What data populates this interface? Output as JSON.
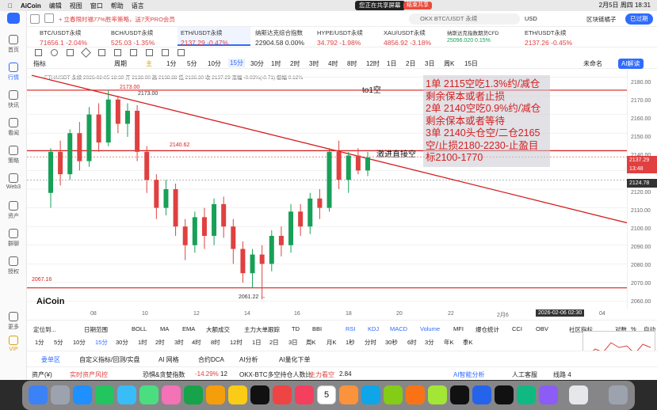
{
  "menubar": {
    "app": "AiCoin",
    "menus": [
      "编辑",
      "视图",
      "窗口",
      "帮助",
      "语言"
    ],
    "sharing": "您正在共享屏幕",
    "end_share": "结束共享",
    "clock": "2月5日 周四 18:31"
  },
  "sidebar": {
    "items": [
      "首页",
      "行情",
      "快讯",
      "看闻",
      "策略",
      "Web3",
      "资产",
      "群聊",
      "授权",
      "更多",
      "VIP"
    ]
  },
  "topbar": {
    "promo": "+ 立春限时福77%胜率策略，送7天PRO会员",
    "search_placeholder": "OKX BTC/USDT 永续",
    "currency": "USD",
    "user": "区块链橘子",
    "status": "已过期"
  },
  "tickers": [
    {
      "name": "BTC/USDT永续",
      "price": "71656.1",
      "change": "-2.04%"
    },
    {
      "name": "BCH/USDT永续",
      "price": "525.03",
      "change": "-1.35%"
    },
    {
      "name": "ETH/USDT永续",
      "price": "2137.29",
      "change": "-0.47%"
    },
    {
      "name": "纳斯达克综合指数",
      "price": "22904.58",
      "change": "0.00%"
    },
    {
      "name": "HYPE/USDT永续",
      "price": "34.792",
      "change": "-1.98%"
    },
    {
      "name": "XAU/USDT永续",
      "price": "4856.92",
      "change": "-3.18%"
    },
    {
      "name": "纳斯达克指数期货CFD",
      "price": "25096.020",
      "change": "0.15%"
    },
    {
      "name": "ETH/USDT永续",
      "price": "2137.26",
      "change": "-0.45%"
    }
  ],
  "toolbar": {
    "indicator": "指标",
    "period": "周期",
    "timeframes": [
      "主",
      "1分",
      "5分",
      "10分",
      "15分",
      "30分",
      "1时",
      "2时",
      "3时",
      "4时",
      "8时",
      "12时",
      "1日",
      "2日",
      "3日",
      "周K",
      "15日"
    ],
    "active_tf": "15分",
    "pending": "未命名",
    "ai": "AI解读"
  },
  "chart": {
    "legend": "ETH/USDT 永续  2026-02-05 18:30  开 2138.00  高 2138.88  低 2136.30  收 2137.29  涨幅 -0.03%(-0.71)  振幅 0.12%",
    "title_note": "to1空",
    "note_box": [
      "1单 2115空吃1.3%约/减仓",
      "剩余保本或者止损",
      "2单 2140空吃0.9%约/减仓",
      "剩余保本或者等待",
      "3单 2140头仓空/二仓2165",
      "空/止损2180-2230-止盈目",
      "标2100-1770"
    ],
    "jinji": "激进直接空",
    "high_label": "2173.00",
    "level_label": "2140.62",
    "low_label": "2067.16",
    "low_point": "2061.22",
    "logo": "AiCoin",
    "y_ticks": [
      "2180.00",
      "2170.00",
      "2160.00",
      "2150.00",
      "2140.00",
      "2130.00",
      "2120.00",
      "2110.00",
      "2100.00",
      "2090.00",
      "2080.00",
      "2070.00",
      "2060.00"
    ],
    "price_tag": "2137.29",
    "countdown": "13:48",
    "cross_price": "2124.78",
    "x_ticks": [
      "08",
      "10",
      "12",
      "14",
      "16",
      "18",
      "20",
      "22",
      "2月6",
      "04"
    ],
    "x_highlight": "2026-02-06 02:30",
    "y_min": 2056,
    "y_max": 2184
  },
  "chart_data": {
    "type": "candlestick",
    "ylim": [
      2056,
      2184
    ],
    "candles": [
      [
        2118,
        2140,
        2110,
        2142
      ],
      [
        2140,
        2128,
        2122,
        2146
      ],
      [
        2128,
        2150,
        2125,
        2152
      ],
      [
        2150,
        2135,
        2130,
        2156
      ],
      [
        2135,
        2160,
        2132,
        2164
      ],
      [
        2160,
        2145,
        2140,
        2166
      ],
      [
        2145,
        2168,
        2143,
        2173
      ],
      [
        2168,
        2155,
        2150,
        2170
      ],
      [
        2155,
        2162,
        2148,
        2166
      ],
      [
        2162,
        2140,
        2135,
        2165
      ],
      [
        2140,
        2125,
        2118,
        2143
      ],
      [
        2125,
        2110,
        2104,
        2128
      ],
      [
        2110,
        2120,
        2106,
        2125
      ],
      [
        2120,
        2100,
        2095,
        2123
      ],
      [
        2100,
        2090,
        2082,
        2104
      ],
      [
        2090,
        2105,
        2086,
        2108
      ],
      [
        2105,
        2095,
        2088,
        2110
      ],
      [
        2095,
        2112,
        2090,
        2115
      ],
      [
        2112,
        2100,
        2094,
        2116
      ],
      [
        2100,
        2088,
        2080,
        2104
      ],
      [
        2088,
        2075,
        2070,
        2092
      ],
      [
        2075,
        2085,
        2067,
        2088
      ],
      [
        2085,
        2080,
        2061,
        2090
      ],
      [
        2080,
        2095,
        2076,
        2098
      ],
      [
        2095,
        2090,
        2084,
        2100
      ],
      [
        2090,
        2108,
        2086,
        2112
      ],
      [
        2108,
        2100,
        2095,
        2112
      ],
      [
        2100,
        2115,
        2096,
        2118
      ],
      [
        2115,
        2110,
        2104,
        2120
      ],
      [
        2110,
        2140,
        2108,
        2142
      ],
      [
        2140,
        2125,
        2120,
        2146
      ],
      [
        2125,
        2138,
        2118,
        2140
      ],
      [
        2138,
        2130,
        2128,
        2142
      ],
      [
        2130,
        2137,
        2127,
        2140
      ]
    ]
  },
  "indicators": [
    "定位到...",
    "日期范围",
    "BOLL",
    "MA",
    "EMA",
    "大额成交",
    "主力大单跟踪",
    "TD",
    "BBI",
    "RSI",
    "KDJ",
    "MACD",
    "Volume",
    "MFI",
    "爆仓统计",
    "CCI",
    "OBV",
    "社区指标",
    "对数",
    "%",
    "自动"
  ],
  "tf_row": [
    "1分",
    "5分",
    "10分",
    "15分",
    "30分",
    "1时",
    "2时",
    "3时",
    "4时",
    "8时",
    "12时",
    "1日",
    "2日",
    "3日",
    "周K",
    "月K",
    "1秒",
    "分时",
    "30秒",
    "6时",
    "3分",
    "年K",
    "季K"
  ],
  "bottom_tabs": [
    "委单区",
    "自定义指标/回测/实盘",
    "AI 网格",
    "合约DCA",
    "AI分析",
    "AI量化下单"
  ],
  "status": {
    "assets": "资产(¥)",
    "risk": "实时资产风控",
    "fear": "恐惧&贪婪指数",
    "fear_change": "-14.29%",
    "fear_val": "12",
    "okx": "OKX-BTC多空持仓人数比",
    "main": "主力看空",
    "main_val": "2.84",
    "ai": "AI智能分析",
    "service": "人工客服",
    "line": "线路 4"
  },
  "colors": {
    "up": "#18a058",
    "down": "#e04040",
    "accent": "#2f6bff",
    "line": "#d42020"
  }
}
